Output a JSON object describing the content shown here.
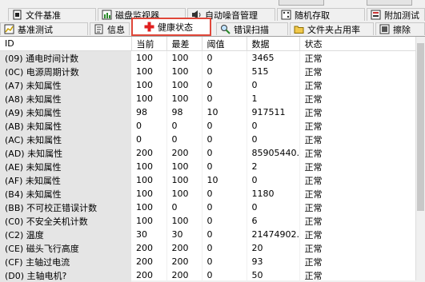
{
  "tabs_row1": [
    "文件基准",
    "磁盘监视器",
    "自动噪音管理",
    "随机存取",
    "附加测试"
  ],
  "tabs_row2": [
    "基准测试",
    "信息",
    "健康状态",
    "错误扫描",
    "文件夹占用率",
    "擦除"
  ],
  "active_tab": "健康状态",
  "columns": [
    "ID",
    "当前",
    "最差",
    "阈值",
    "数据",
    "状态"
  ],
  "rows": [
    {
      "id": "(09) 通电时间计数",
      "cur": "100",
      "worst": "100",
      "thr": "0",
      "data": "3465",
      "status": "正常"
    },
    {
      "id": "(0C) 电源周期计数",
      "cur": "100",
      "worst": "100",
      "thr": "0",
      "data": "515",
      "status": "正常"
    },
    {
      "id": "(A7) 未知属性",
      "cur": "100",
      "worst": "100",
      "thr": "0",
      "data": "0",
      "status": "正常"
    },
    {
      "id": "(A8) 未知属性",
      "cur": "100",
      "worst": "100",
      "thr": "0",
      "data": "1",
      "status": "正常"
    },
    {
      "id": "(A9) 未知属性",
      "cur": "98",
      "worst": "98",
      "thr": "10",
      "data": "917511",
      "status": "正常"
    },
    {
      "id": "(AB) 未知属性",
      "cur": "0",
      "worst": "0",
      "thr": "0",
      "data": "0",
      "status": "正常"
    },
    {
      "id": "(AC) 未知属性",
      "cur": "0",
      "worst": "0",
      "thr": "0",
      "data": "0",
      "status": "正常"
    },
    {
      "id": "(AD) 未知属性",
      "cur": "200",
      "worst": "200",
      "thr": "0",
      "data": "85905440...",
      "status": "正常"
    },
    {
      "id": "(AE) 未知属性",
      "cur": "100",
      "worst": "100",
      "thr": "0",
      "data": "2",
      "status": "正常"
    },
    {
      "id": "(AF) 未知属性",
      "cur": "100",
      "worst": "100",
      "thr": "10",
      "data": "0",
      "status": "正常"
    },
    {
      "id": "(B4) 未知属性",
      "cur": "100",
      "worst": "100",
      "thr": "0",
      "data": "1180",
      "status": "正常"
    },
    {
      "id": "(BB) 不可校正错误计数",
      "cur": "100",
      "worst": "0",
      "thr": "0",
      "data": "0",
      "status": "正常"
    },
    {
      "id": "(C0) 不安全关机计数",
      "cur": "100",
      "worst": "100",
      "thr": "0",
      "data": "6",
      "status": "正常"
    },
    {
      "id": "(C2) 温度",
      "cur": "30",
      "worst": "30",
      "thr": "0",
      "data": "21474902...",
      "status": "正常"
    },
    {
      "id": "(CE) 磁头飞行高度",
      "cur": "200",
      "worst": "200",
      "thr": "0",
      "data": "20",
      "status": "正常"
    },
    {
      "id": "(CF) 主轴过电流",
      "cur": "200",
      "worst": "200",
      "thr": "0",
      "data": "93",
      "status": "正常"
    },
    {
      "id": "(D0) 主轴电机?",
      "cur": "200",
      "worst": "200",
      "thr": "0",
      "data": "50",
      "status": "正常"
    }
  ],
  "icons": {
    "文件基准": "file-benchmark-icon",
    "磁盘监视器": "disk-monitor-icon",
    "自动噪音管理": "speaker-icon",
    "随机存取": "random-access-icon",
    "附加测试": "extra-tests-icon",
    "基准测试": "benchmark-icon",
    "信息": "info-icon",
    "健康状态": "health-cross-icon",
    "错误扫描": "magnifier-icon",
    "文件夹占用率": "folder-icon",
    "擦除": "erase-icon"
  },
  "colors": {
    "active_tab_border": "#e0473a",
    "health_icon": "#e02020",
    "name_column_bg": "#e5e5e5"
  }
}
